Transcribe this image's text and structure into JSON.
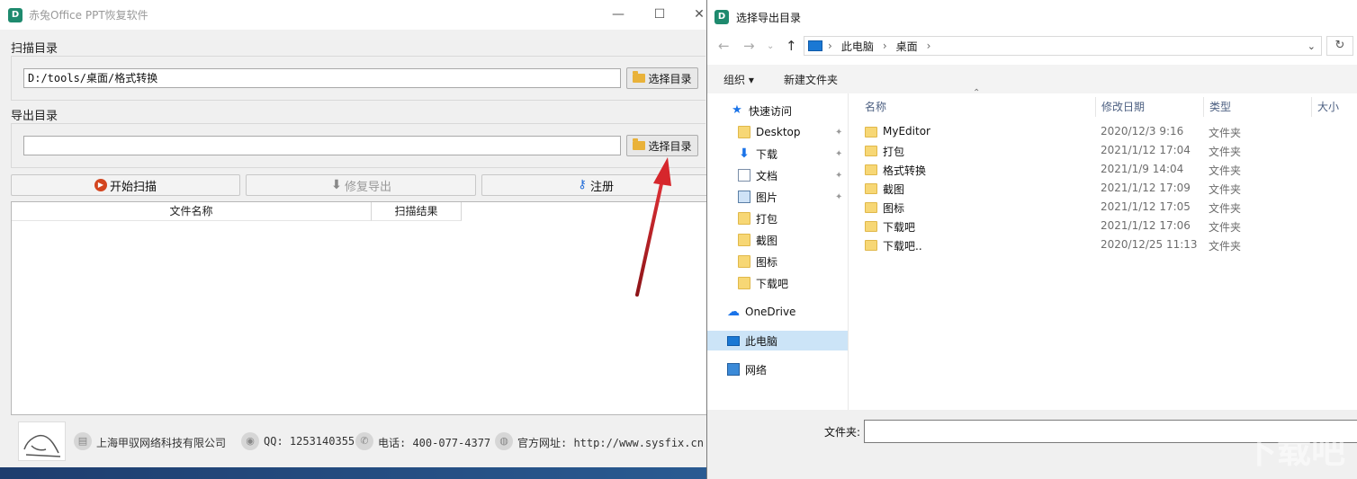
{
  "app": {
    "title": "赤兔Office PPT恢复软件",
    "minimize": "—",
    "maximize": "☐",
    "close": "✕",
    "scan_dir_label": "扫描目录",
    "scan_dir_value": "D:/tools/桌面/格式转换",
    "select_dir_label": "选择目录",
    "export_dir_label": "导出目录",
    "export_dir_value": "",
    "start_scan": "开始扫描",
    "repair_export": "修复导出",
    "register": "注册",
    "col_filename": "文件名称",
    "col_result": "扫描结果",
    "footer": {
      "company": "上海甲驭网络科技有限公司",
      "qq": "QQ: 1253140355",
      "phone": "电话: 400-077-4377",
      "website": "官方网址: http://www.sysfix.cn"
    }
  },
  "dialog": {
    "title": "选择导出目录",
    "breadcrumb": [
      "此电脑",
      "桌面"
    ],
    "organize": "组织 ▾",
    "new_folder": "新建文件夹",
    "nav": [
      {
        "label": "快速访问",
        "icon": "star-icon"
      },
      {
        "label": "Desktop",
        "icon": "folder-icon",
        "pinned": true
      },
      {
        "label": "下载",
        "icon": "download-icon",
        "pinned": true
      },
      {
        "label": "文档",
        "icon": "document-icon",
        "pinned": true
      },
      {
        "label": "图片",
        "icon": "picture-icon",
        "pinned": true
      },
      {
        "label": "打包",
        "icon": "folder-icon"
      },
      {
        "label": "截图",
        "icon": "folder-icon"
      },
      {
        "label": "图标",
        "icon": "folder-icon"
      },
      {
        "label": "下载吧",
        "icon": "folder-icon"
      },
      {
        "label": "OneDrive",
        "icon": "cloud-icon"
      },
      {
        "label": "此电脑",
        "icon": "computer-icon",
        "selected": true
      },
      {
        "label": "网络",
        "icon": "network-icon"
      }
    ],
    "columns": {
      "name": "名称",
      "date": "修改日期",
      "type": "类型",
      "size": "大小"
    },
    "files": [
      {
        "name": "MyEditor",
        "date": "2020/12/3 9:16",
        "type": "文件夹"
      },
      {
        "name": "打包",
        "date": "2021/1/12 17:04",
        "type": "文件夹"
      },
      {
        "name": "格式转换",
        "date": "2021/1/9 14:04",
        "type": "文件夹"
      },
      {
        "name": "截图",
        "date": "2021/1/12 17:09",
        "type": "文件夹"
      },
      {
        "name": "图标",
        "date": "2021/1/12 17:05",
        "type": "文件夹"
      },
      {
        "name": "下载吧",
        "date": "2021/1/12 17:06",
        "type": "文件夹"
      },
      {
        "name": "下载吧..",
        "date": "2020/12/25 11:13",
        "type": "文件夹"
      }
    ],
    "folder_label": "文件夹:",
    "folder_value": "",
    "refresh": "↻"
  },
  "watermark": "下载吧",
  "colors": {
    "arrow": "#c8262c",
    "selection": "#cce4f7",
    "accent": "#1a73e8"
  }
}
